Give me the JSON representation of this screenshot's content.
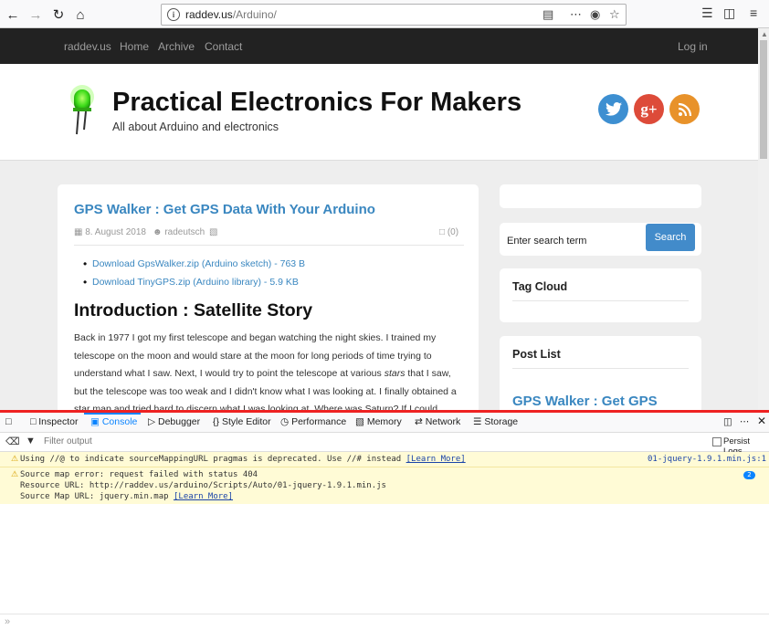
{
  "browser": {
    "url_host": "raddev.us",
    "url_path": "/Arduino/"
  },
  "nav": {
    "brand": "raddev.us",
    "items": [
      "Home",
      "Archive",
      "Contact"
    ],
    "login": "Log in"
  },
  "header": {
    "title": "Practical Electronics For Makers",
    "subtitle": "All about Arduino and electronics",
    "social_colors": {
      "twitter": "#3d8fd1",
      "gplus": "#dd4b39",
      "rss": "#e8922a"
    },
    "gplus_label": "g+"
  },
  "post": {
    "title": "GPS Walker : Get GPS Data With Your Arduino",
    "date": "8. August 2018",
    "author": "radeutsch",
    "comments": "(0)",
    "downloads": [
      "Download GpsWalker.zip (Arduino sketch) - 763 B",
      "Download TinyGPS.zip (Arduino library) - 5.9 KB"
    ],
    "section_title": "Introduction : Satellite Story",
    "para1": "Back in 1977 I got my first telescope and began watching the night skies.  I trained my telescope on the moon and would stare at the moon for long periods of time trying to understand what I saw.  Next, I would try to point the telescope at various ",
    "para_em": "stars",
    "para2": " that I saw, but the telescope was too weak and I didn't know what I was looking at. I finally obtained a star map and tried hard to discern what I was looking at.  Where was Saturn?  If I could"
  },
  "sidebar": {
    "search_placeholder": "Enter search term",
    "search_button": "Search",
    "tag_cloud": "Tag Cloud",
    "post_list": "Post List",
    "post_list_item": "GPS Walker : Get GPS"
  },
  "devtools": {
    "tabs": [
      "Inspector",
      "Console",
      "Debugger",
      "Style Editor",
      "Performance",
      "Memory",
      "Network",
      "Storage"
    ],
    "filter_placeholder": "Filter output",
    "persist_logs": "Persist Logs",
    "msg1": "Using //@ to indicate sourceMappingURL pragmas is deprecated. Use //# instead ",
    "msg1_link": "[Learn More]",
    "msg1_src": "01-jquery-1.9.1.min.js:1",
    "msg2_line1": "Source map error: request failed with status 404",
    "msg2_line2": "Resource URL: http://raddev.us/arduino/Scripts/Auto/01-jquery-1.9.1.min.js",
    "msg2_line3": "Source Map URL: jquery.min.map ",
    "msg2_link": "[Learn More]",
    "msg2_count": "2"
  }
}
